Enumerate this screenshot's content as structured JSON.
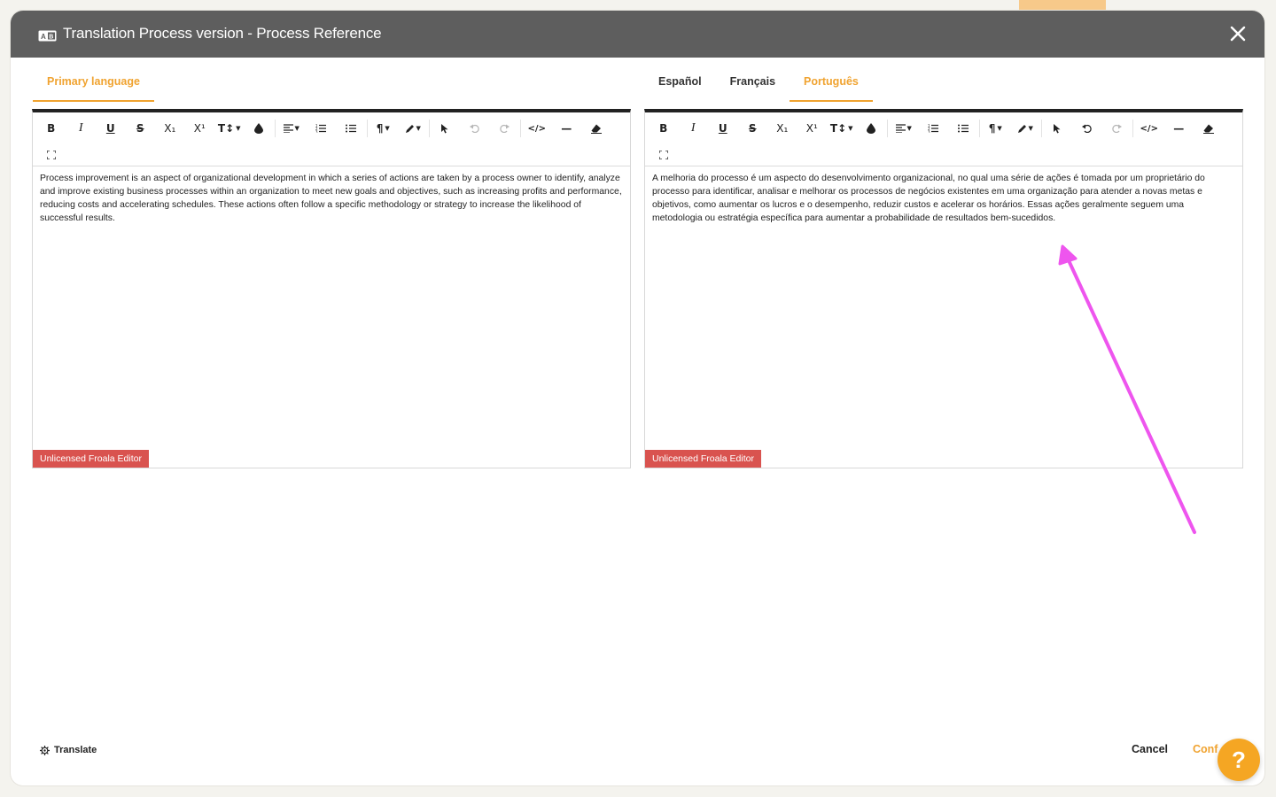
{
  "header": {
    "title": "Translation Process version - Process Reference",
    "icon": "translate-badge-icon",
    "close_icon": "close-icon"
  },
  "left_panel": {
    "tabs": [
      {
        "label": "Primary language",
        "active": true
      }
    ],
    "content": "Process improvement is an aspect of organizational development in which a series of actions are taken by a process owner to identify, analyze and improve existing business processes within an organization to meet new goals and objectives, such as increasing profits and performance, reducing costs and accelerating schedules. These actions often follow a specific methodology or strategy to increase the likelihood of successful results.",
    "footer_badge": "Unlicensed Froala Editor"
  },
  "right_panel": {
    "tabs": [
      {
        "label": "Español",
        "active": false
      },
      {
        "label": "Français",
        "active": false
      },
      {
        "label": "Português",
        "active": true
      }
    ],
    "content": "A melhoria do processo é um aspecto do desenvolvimento organizacional, no qual uma série de ações é tomada por um proprietário do processo para identificar, analisar e melhorar os processos de negócios existentes em uma organização para atender a novas metas e objetivos, como aumentar os lucros e o desempenho, reduzir custos e acelerar os horários. Essas ações geralmente seguem uma metodologia ou estratégia específica para aumentar a probabilidade de resultados bem-sucedidos.",
    "footer_badge": "Unlicensed Froala Editor"
  },
  "toolbar": {
    "bold": "B",
    "italic": "I",
    "underline": "U",
    "strike": "S",
    "subscript": "X₁",
    "superscript": "X¹",
    "font_size": "T↕",
    "paragraph": "¶",
    "code_view": "</>",
    "hr": "—"
  },
  "footer": {
    "translate_label": "Translate",
    "cancel_label": "Cancel",
    "confirm_label": "Conf"
  },
  "help": {
    "label": "?"
  },
  "colors": {
    "accent": "#f0a330",
    "header_bg": "#5e5e5e",
    "badge_red": "#d9534f",
    "annotation_arrow": "#ee55ee"
  }
}
